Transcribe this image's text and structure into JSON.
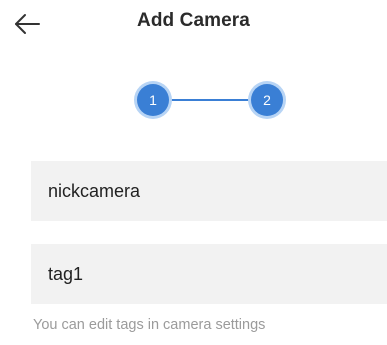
{
  "header": {
    "title": "Add Camera",
    "back_icon": "arrow-left-icon"
  },
  "stepper": {
    "steps": [
      {
        "label": "1"
      },
      {
        "label": "2"
      }
    ],
    "current_step": 2,
    "accent_color": "#3a7fd5",
    "ring_color": "#b7d4f5"
  },
  "form": {
    "camera_name": {
      "value": "nickcamera"
    },
    "tags": {
      "value": "tag1"
    },
    "hint": "You can edit tags in camera settings"
  },
  "colors": {
    "field_background": "#f2f2f2",
    "hint_text": "#9b9b9b",
    "title_text": "#2b2b2b"
  }
}
